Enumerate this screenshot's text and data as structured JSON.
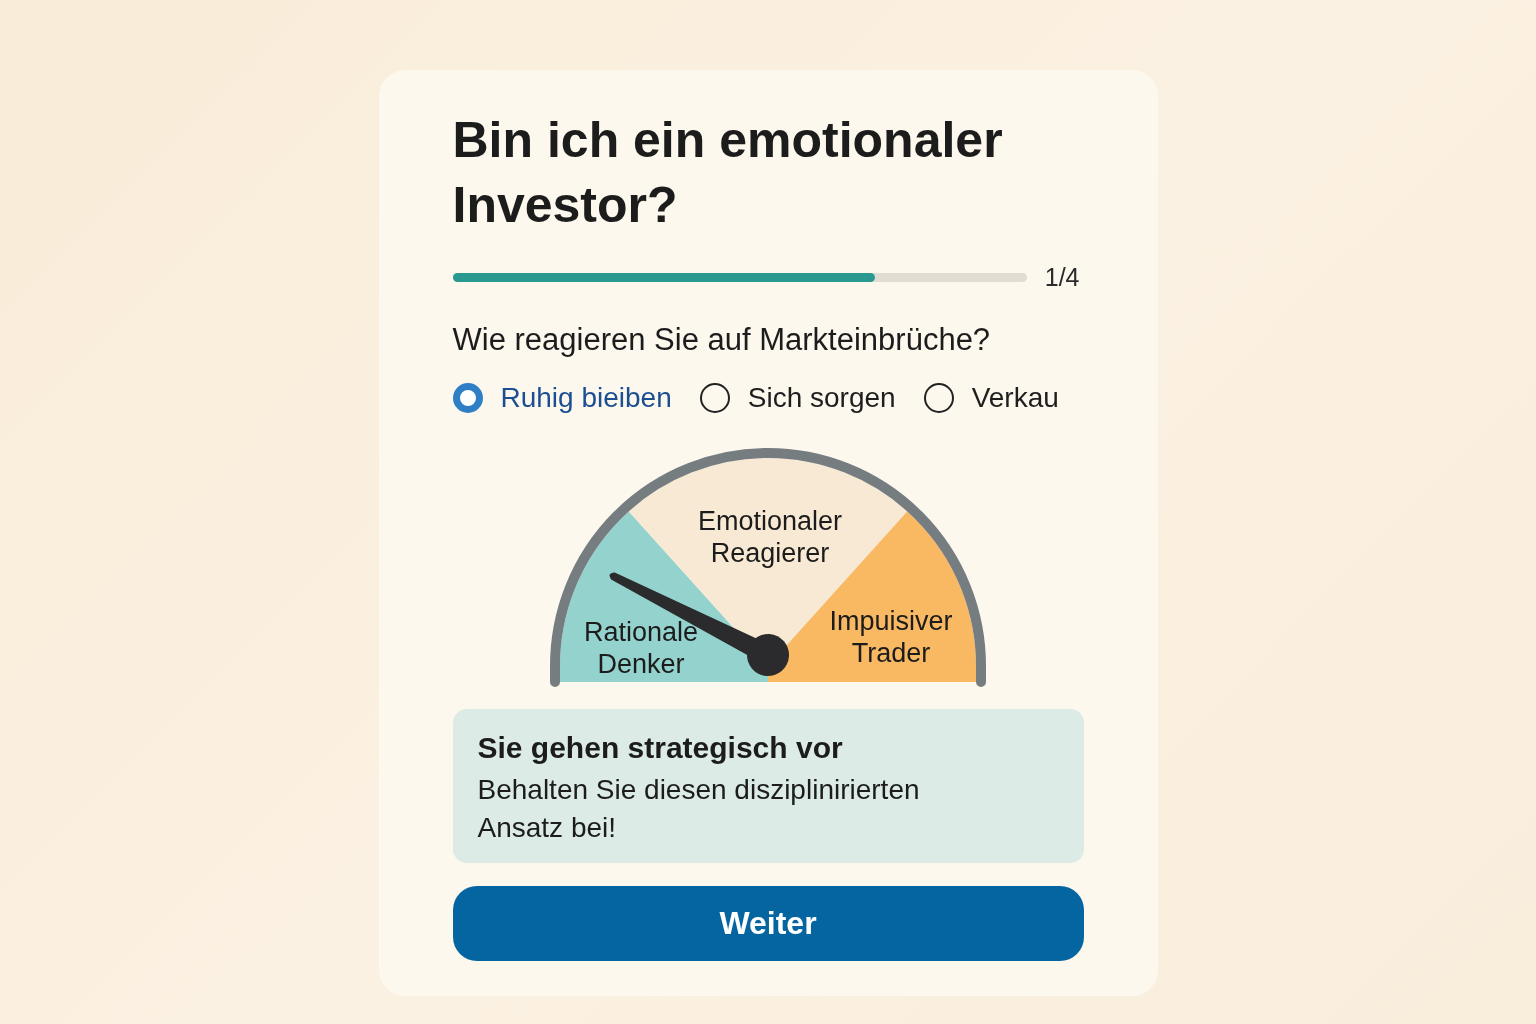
{
  "card": {
    "title": "Bin ich ein emotionaler Investor?",
    "progress": {
      "level": 0.735,
      "label": "1/4"
    },
    "question": "Wie reagieren Sie auf Markteinbrüche?",
    "options": [
      {
        "label": "Ruhig bieiben",
        "selected": true
      },
      {
        "label": "Sich sorgen",
        "selected": false
      },
      {
        "label": "Verkau",
        "selected": false
      }
    ],
    "gauge": {
      "level": 0.15,
      "segments": [
        {
          "lines": [
            "Rationale",
            "Denker"
          ],
          "color": "#93d2cd"
        },
        {
          "lines": [
            "Emotionaler",
            "Reagierer"
          ],
          "color": "#f8e9d4"
        },
        {
          "lines": [
            "Impuisiver",
            "Trader"
          ],
          "color": "#f9b862"
        }
      ]
    },
    "result": {
      "title": "Sie gehen strategisch vor",
      "text": "Behalten Sie diesen disziplinirierten Ansatz bei!"
    },
    "button": "Weiter"
  }
}
